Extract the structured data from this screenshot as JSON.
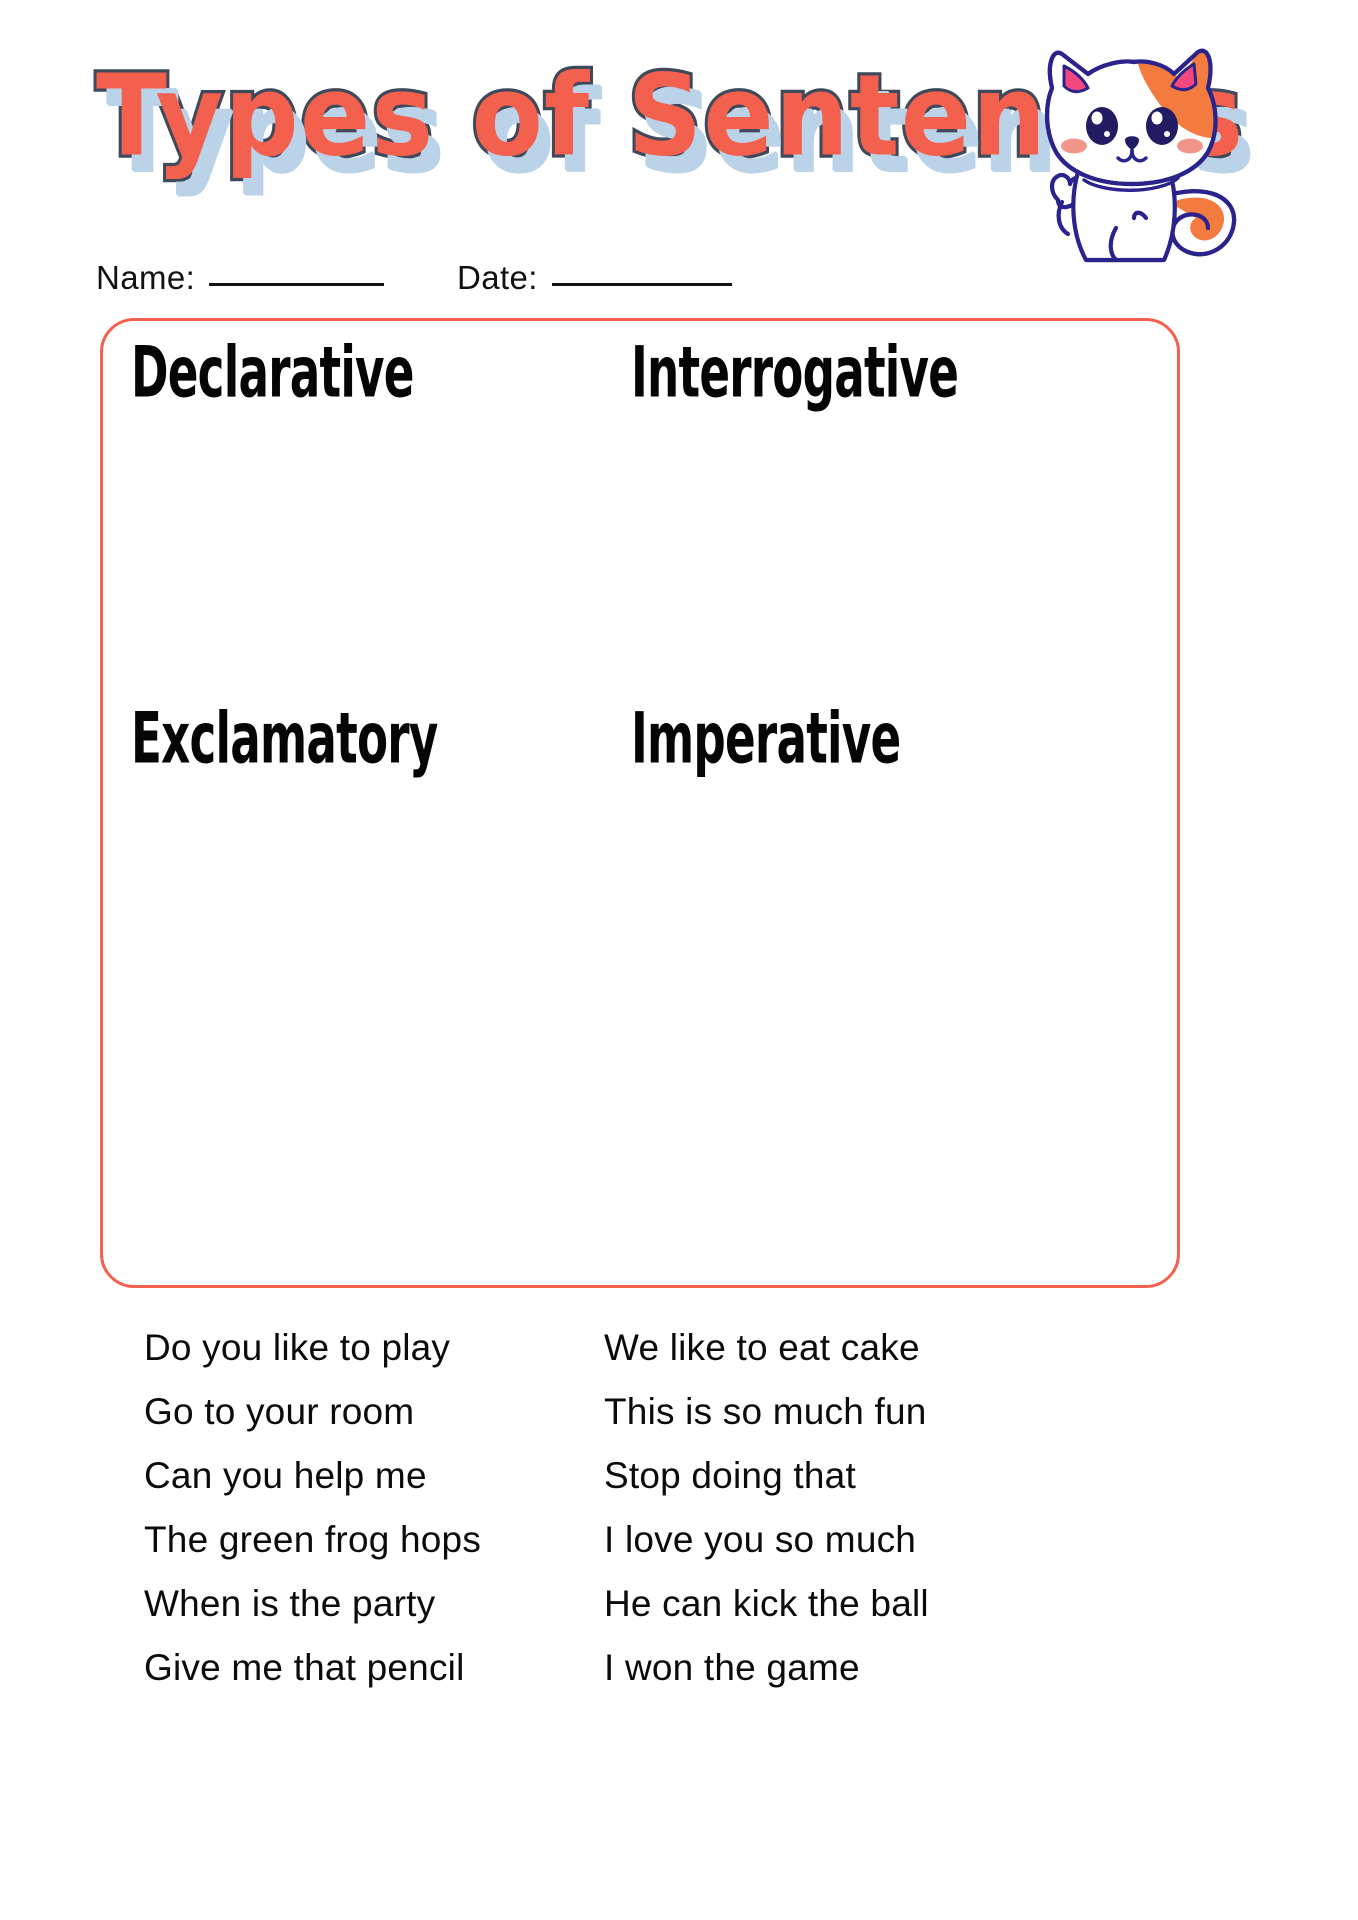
{
  "worksheet": {
    "title": "Types of Sentences",
    "theme": {
      "title_fill": "#F4604E",
      "title_outline": "#3E4A5C",
      "title_shadow": "#BBD3E8",
      "box_border": "#F4604E",
      "text": "#000000",
      "cat_outline": "#2A238C",
      "cat_patch": "#F47B3F",
      "cat_ear_inner": "#F4477F",
      "cat_blush": "#F2968C"
    }
  },
  "header": {
    "name_label": "Name:",
    "date_label": "Date:",
    "name_value": "",
    "date_value": "",
    "name_placeholder": "",
    "date_placeholder": ""
  },
  "sort_box": {
    "quadrants": [
      {
        "id": "declarative",
        "label": "Declarative",
        "position": "top-left"
      },
      {
        "id": "interrogative",
        "label": "Interrogative",
        "position": "top-right"
      },
      {
        "id": "exclamatory",
        "label": "Exclamatory",
        "position": "bottom-left"
      },
      {
        "id": "imperative",
        "label": "Imperative",
        "position": "bottom-right"
      }
    ]
  },
  "word_bank": {
    "left_column": [
      "Do you like to play",
      "Go to your room",
      "Can you help me",
      "The green frog hops",
      "When is the party",
      "Give me that pencil"
    ],
    "right_column": [
      "We like to eat cake",
      "This is so much fun",
      "Stop doing that",
      "I love you so much",
      "He can kick the ball",
      "I won the game"
    ]
  }
}
